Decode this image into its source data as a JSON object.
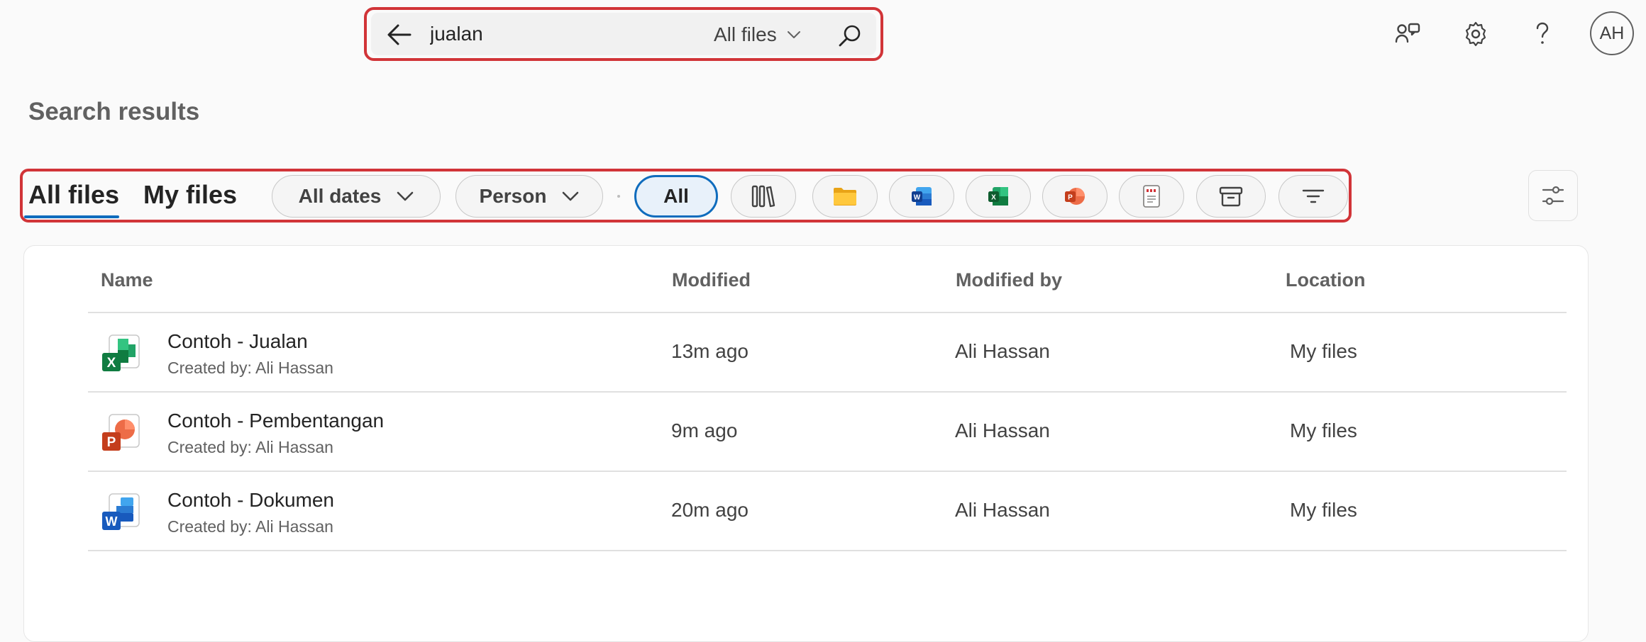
{
  "search": {
    "query": "jualan",
    "scope_label": "All files"
  },
  "header": {
    "avatar_initials": "AH"
  },
  "page": {
    "title": "Search results"
  },
  "tabs": [
    {
      "label": "All files",
      "selected": true
    },
    {
      "label": "My files",
      "selected": false
    }
  ],
  "filters": {
    "dates_label": "All dates",
    "person_label": "Person",
    "all_label": "All",
    "type_icons": [
      "libraries-icon",
      "folder-icon",
      "word-icon",
      "excel-icon",
      "powerpoint-icon",
      "pdf-icon",
      "archive-icon",
      "filter-icon"
    ]
  },
  "colors": {
    "accent": "#0f6cbd",
    "highlight_outline": "#d13438",
    "excel": "#107c41",
    "word": "#185abd",
    "powerpoint": "#c43e1c"
  },
  "table": {
    "columns": [
      "Name",
      "Modified",
      "Modified by",
      "Location"
    ],
    "rows": [
      {
        "type": "excel",
        "name": "Contoh - Jualan",
        "created_by": "Created by: Ali Hassan",
        "modified": "13m ago",
        "modified_by": "Ali Hassan",
        "location": "My files"
      },
      {
        "type": "powerpoint",
        "name": "Contoh - Pembentangan",
        "created_by": "Created by: Ali Hassan",
        "modified": "9m ago",
        "modified_by": "Ali Hassan",
        "location": "My files"
      },
      {
        "type": "word",
        "name": "Contoh - Dokumen",
        "created_by": "Created by: Ali Hassan",
        "modified": "20m ago",
        "modified_by": "Ali Hassan",
        "location": "My files"
      }
    ]
  }
}
